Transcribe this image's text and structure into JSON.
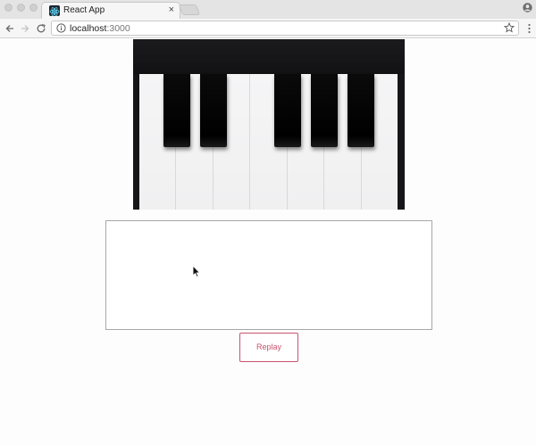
{
  "browser": {
    "tab": {
      "title": "React App",
      "close_glyph": "×",
      "favicon": "react-logo-icon"
    },
    "address_bar": {
      "host": "localhost",
      "port": ":3000"
    },
    "icons": {
      "back": "back-arrow-icon",
      "forward": "forward-arrow-icon",
      "reload": "reload-icon",
      "info": "info-icon",
      "bookmark": "star-icon",
      "menu": "kebab-menu-icon",
      "profile": "profile-icon"
    }
  },
  "page": {
    "piano": {
      "white_key_count": 7,
      "black_keys": [
        "C#",
        "D#",
        "F#",
        "G#",
        "A#"
      ]
    },
    "replay_button": {
      "label": "Replay"
    }
  },
  "colors": {
    "accent": "#c8546f",
    "piano_frame": "#161618",
    "white_key": "#f3f3f4",
    "black_key": "#000000"
  }
}
